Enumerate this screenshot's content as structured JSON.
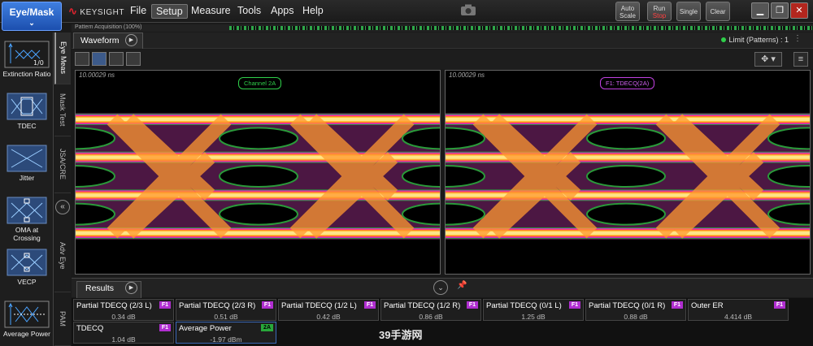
{
  "mode_button": {
    "label": "Eye/Mask"
  },
  "brand": {
    "name": "KEYSIGHT"
  },
  "menus": [
    "File",
    "Setup",
    "Measure",
    "Tools",
    "Apps",
    "Help"
  ],
  "toolbar": {
    "auto_scale_line1": "Auto",
    "auto_scale_line2": "Scale",
    "run_line1": "Run",
    "run_line2": "Stop",
    "single": "Single",
    "clear": "Clear"
  },
  "acquisition": {
    "label": "Pattern Acquisition  (100%)"
  },
  "sidebar": {
    "items": [
      {
        "label": "Extinction Ratio",
        "icon": "extinction-ratio-icon",
        "sub": "1/0"
      },
      {
        "label": "TDEC",
        "icon": "tdec-icon"
      },
      {
        "label": "Jitter",
        "icon": "jitter-icon"
      },
      {
        "label": "OMA at Crossing",
        "icon": "oma-crossing-icon"
      },
      {
        "label": "VECP",
        "icon": "vecp-icon"
      },
      {
        "label": "Average Power",
        "icon": "average-power-icon"
      }
    ]
  },
  "vertical_tabs": [
    "Eye Meas",
    "Mask Test",
    "JSA/CRE",
    "Adv Eye",
    "PAM"
  ],
  "waveform": {
    "tab_label": "Waveform",
    "limit": "Limit (Patterns) : 1",
    "left_panel": {
      "timebase": "10.00029 ns",
      "channel": "Channel 2A",
      "channel_color": "#2fcf4a"
    },
    "right_panel": {
      "timebase": "10.00029 ns",
      "channel": "F1: TDECQ(2A)",
      "channel_color": "#c040e0"
    }
  },
  "results": {
    "tab_label": "Results",
    "row1": [
      {
        "name": "Partial TDECQ (2/3 L)",
        "value": "0.34 dB",
        "badge": "F1"
      },
      {
        "name": "Partial TDECQ (2/3 R)",
        "value": "0.51 dB",
        "badge": "F1"
      },
      {
        "name": "Partial TDECQ (1/2 L)",
        "value": "0.42 dB",
        "badge": "F1"
      },
      {
        "name": "Partial TDECQ (1/2 R)",
        "value": "0.86 dB",
        "badge": "F1"
      },
      {
        "name": "Partial TDECQ (0/1 L)",
        "value": "1.25 dB",
        "badge": "F1"
      },
      {
        "name": "Partial TDECQ (0/1 R)",
        "value": "0.88 dB",
        "badge": "F1"
      },
      {
        "name": "Outer ER",
        "value": "4.414 dB",
        "badge": "F1"
      }
    ],
    "row2": [
      {
        "name": "TDECQ",
        "value": "1.04 dB",
        "badge": "F1"
      },
      {
        "name": "Average Power",
        "value": "-1.97 dBm",
        "badge": "2A"
      }
    ]
  },
  "watermark": "39手游网"
}
